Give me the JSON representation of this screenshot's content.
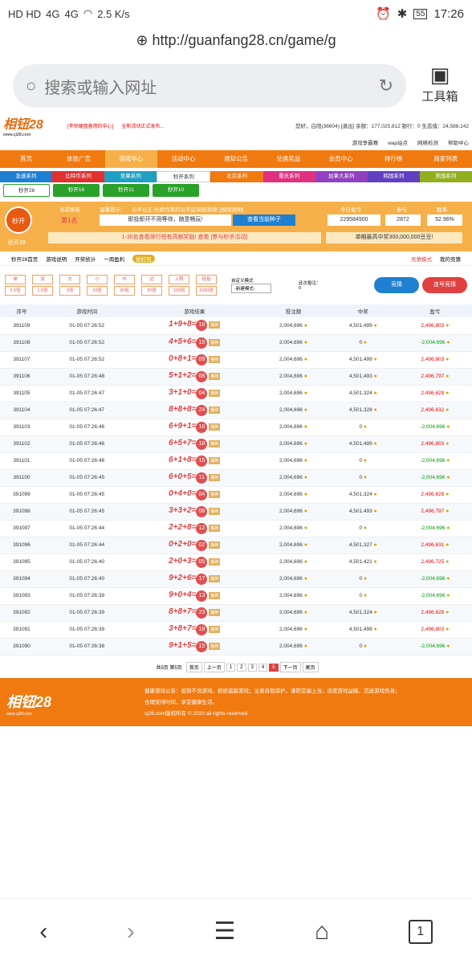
{
  "status": {
    "hd_icons": "HD HD",
    "signal1": "4G",
    "signal2": "4G",
    "speed": "2.5 K/s",
    "battery": "55",
    "time": "17:26"
  },
  "browser": {
    "url": "http://guanfang28.cn/game/g",
    "search_placeholder": "搜索或输入网址",
    "toolbox_label": "工具箱"
  },
  "site": {
    "logo": "相钮28",
    "logo_sub": "www.cj28.com",
    "notice1": "[李悦硬盘备用的中心]",
    "notice2": "全新活动正式发布...",
    "account": "您好，白阳(36604) [退出]  余额：177,025,812  银行：0  生态值：24,588,142",
    "subnav": [
      "游戏争霸赛",
      "wap站点",
      "网络检测",
      "帮助中心"
    ],
    "mainnav": [
      "首页",
      "体验广告",
      "游戏中心",
      "活动中心",
      "通知公告",
      "兑换奖品",
      "会员中心",
      "排行榜",
      "商家列表"
    ],
    "series": [
      "急速系列",
      "比特币系列",
      "竞果系列",
      "秒开系列",
      "北京系列",
      "重庆系列",
      "加拿大系列",
      "韩国系列",
      "美国系列"
    ],
    "series_colors": [
      "#1f7fd0",
      "#e03030",
      "#20a0c0",
      "#ffffff",
      "#f07a10",
      "#e03080",
      "#9040c0",
      "#6040c0",
      "#90b020"
    ],
    "games": [
      "秒开28",
      "秒开16",
      "秒开11",
      "秒开10"
    ],
    "info": {
      "badge": "秒开",
      "badge_label": "秒开28",
      "rank_label": "当前排名",
      "rank_value": "第1名",
      "tip_label": "温馨提示：",
      "tip_text": "公平公正·杜绝作弊的公平区块链游戏! [规则说明]",
      "wait_text": "即投即开不用等待，随意畅玩!",
      "seed_btn": "查看当前种子",
      "today_label": "今日盈亏",
      "today_value": "229584900",
      "join_label": "参与",
      "join_value": "2872",
      "winrate_label": "胜率",
      "winrate_value": "52.96%",
      "promo": "1-30名查看排行榜有高额奖励! 查看  [参与秒杀活动]",
      "max_win": "单期最高中奖300,000,000豆豆!"
    },
    "tools": [
      "秒开28首页",
      "游戏说明",
      "开奖统计",
      "一周盈利",
      "抢红包"
    ],
    "tools_right": [
      "竞猜模式",
      "我的竞猜"
    ],
    "bet_row1": [
      "单",
      "双",
      "大",
      "小",
      "中",
      "边",
      "上限",
      "倍投"
    ],
    "bet_row2": [
      "0.5倍",
      "1.5倍",
      "2倍",
      "10倍",
      "30倍",
      "50倍",
      "100倍",
      "1000倍"
    ],
    "custom_mode_label": "自定义模式",
    "custom_mode_value": "-新建模式-",
    "this_bet_label": "此次投注：",
    "this_bet_value": "0",
    "btn_bet": "竞猜",
    "btn_batch": "连号竞猜",
    "table_headers": [
      "序号",
      "游戏时间",
      "游戏结果",
      "投注额",
      "中奖",
      "盈亏"
    ],
    "rows": [
      {
        "id": "391109",
        "time": "01-05 07:26:52",
        "a": "1",
        "b": "9",
        "c": "8",
        "sum": "18",
        "bet": "2,004,696",
        "win": "4,501,499",
        "pl": "2,496,803",
        "plsign": "pos"
      },
      {
        "id": "391108",
        "time": "01-05 07:26:52",
        "a": "4",
        "b": "5",
        "c": "6",
        "sum": "15",
        "bet": "2,004,696",
        "win": "0",
        "pl": "-2,004,696",
        "plsign": "neg"
      },
      {
        "id": "391107",
        "time": "01-05 07:26:52",
        "a": "0",
        "b": "8",
        "c": "1",
        "sum": "09",
        "bet": "2,004,696",
        "win": "4,501,499",
        "pl": "2,496,803",
        "plsign": "pos"
      },
      {
        "id": "391106",
        "time": "01-05 07:26:48",
        "a": "5",
        "b": "1",
        "c": "2",
        "sum": "08",
        "bet": "2,004,696",
        "win": "4,501,493",
        "pl": "2,496,797",
        "plsign": "pos"
      },
      {
        "id": "391105",
        "time": "01-05 07:26:47",
        "a": "3",
        "b": "1",
        "c": "0",
        "sum": "04",
        "bet": "2,004,696",
        "win": "4,501,324",
        "pl": "2,496,628",
        "plsign": "pos"
      },
      {
        "id": "391104",
        "time": "01-05 07:26:47",
        "a": "8",
        "b": "8",
        "c": "8",
        "sum": "24",
        "bet": "2,004,696",
        "win": "4,501,328",
        "pl": "2,496,632",
        "plsign": "pos"
      },
      {
        "id": "391103",
        "time": "01-05 07:26:46",
        "a": "6",
        "b": "9",
        "c": "1",
        "sum": "16",
        "bet": "2,004,696",
        "win": "0",
        "pl": "-2,004,696",
        "plsign": "neg"
      },
      {
        "id": "391102",
        "time": "01-05 07:26:46",
        "a": "6",
        "b": "5",
        "c": "7",
        "sum": "18",
        "bet": "2,004,696",
        "win": "4,501,499",
        "pl": "2,496,803",
        "plsign": "pos"
      },
      {
        "id": "391101",
        "time": "01-05 07:26:46",
        "a": "6",
        "b": "1",
        "c": "8",
        "sum": "15",
        "bet": "2,004,696",
        "win": "0",
        "pl": "-2,004,696",
        "plsign": "neg"
      },
      {
        "id": "391100",
        "time": "01-05 07:26:45",
        "a": "6",
        "b": "0",
        "c": "5",
        "sum": "11",
        "bet": "2,004,696",
        "win": "0",
        "pl": "-2,004,696",
        "plsign": "neg"
      },
      {
        "id": "391099",
        "time": "01-05 07:26:45",
        "a": "0",
        "b": "4",
        "c": "0",
        "sum": "04",
        "bet": "2,004,696",
        "win": "4,501,324",
        "pl": "2,496,628",
        "plsign": "pos"
      },
      {
        "id": "391098",
        "time": "01-05 07:26:45",
        "a": "3",
        "b": "3",
        "c": "2",
        "sum": "08",
        "bet": "2,004,696",
        "win": "4,501,493",
        "pl": "2,496,797",
        "plsign": "pos"
      },
      {
        "id": "391097",
        "time": "01-05 07:26:44",
        "a": "2",
        "b": "2",
        "c": "8",
        "sum": "12",
        "bet": "2,004,696",
        "win": "0",
        "pl": "-2,004,696",
        "plsign": "neg"
      },
      {
        "id": "391096",
        "time": "01-05 07:26:44",
        "a": "0",
        "b": "2",
        "c": "0",
        "sum": "02",
        "bet": "2,004,696",
        "win": "4,501,327",
        "pl": "2,496,631",
        "plsign": "pos"
      },
      {
        "id": "391095",
        "time": "01-05 07:26:40",
        "a": "2",
        "b": "0",
        "c": "3",
        "sum": "05",
        "bet": "2,004,696",
        "win": "4,501,421",
        "pl": "2,496,725",
        "plsign": "pos"
      },
      {
        "id": "391094",
        "time": "01-05 07:26:40",
        "a": "9",
        "b": "2",
        "c": "6",
        "sum": "17",
        "bet": "2,004,696",
        "win": "0",
        "pl": "-2,004,696",
        "plsign": "neg"
      },
      {
        "id": "391093",
        "time": "01-05 07:26:39",
        "a": "9",
        "b": "0",
        "c": "4",
        "sum": "13",
        "bet": "2,004,696",
        "win": "0",
        "pl": "-2,004,696",
        "plsign": "neg"
      },
      {
        "id": "391092",
        "time": "01-05 07:26:39",
        "a": "8",
        "b": "8",
        "c": "7",
        "sum": "23",
        "bet": "2,004,696",
        "win": "4,501,324",
        "pl": "2,496,628",
        "plsign": "pos"
      },
      {
        "id": "391091",
        "time": "01-05 07:26:39",
        "a": "3",
        "b": "8",
        "c": "7",
        "sum": "18",
        "bet": "2,004,696",
        "win": "4,501,499",
        "pl": "2,496,803",
        "plsign": "pos"
      },
      {
        "id": "391090",
        "time": "01-05 07:26:38",
        "a": "9",
        "b": "1",
        "c": "5",
        "sum": "15",
        "bet": "2,004,696",
        "win": "0",
        "pl": "-2,004,696",
        "plsign": "neg"
      }
    ],
    "mode_tag": "搬砖",
    "pager": {
      "summary": "共5页 第5页",
      "first": "首页",
      "prev": "上一页",
      "pages": [
        "1",
        "2",
        "3",
        "4",
        "5"
      ],
      "current": "5",
      "next": "下一页",
      "last": "尾页"
    },
    "footer": {
      "logo": "相钮28",
      "logo_sub": "www.cj28.com",
      "line1": "健康游戏公告：抵制不良游戏，拒绝盗版游戏；注意自我保护，谨防受骗上当；适度游戏益脑，沉迷游戏伤身；",
      "line2": "合理安排时间，享受健康生活。",
      "line3": "cj28.com版权所有 © 2020 all rights reserved."
    }
  },
  "navbar": {
    "back": "‹",
    "forward": "›",
    "menu": "☰",
    "home": "⌂",
    "tabs": "1"
  }
}
